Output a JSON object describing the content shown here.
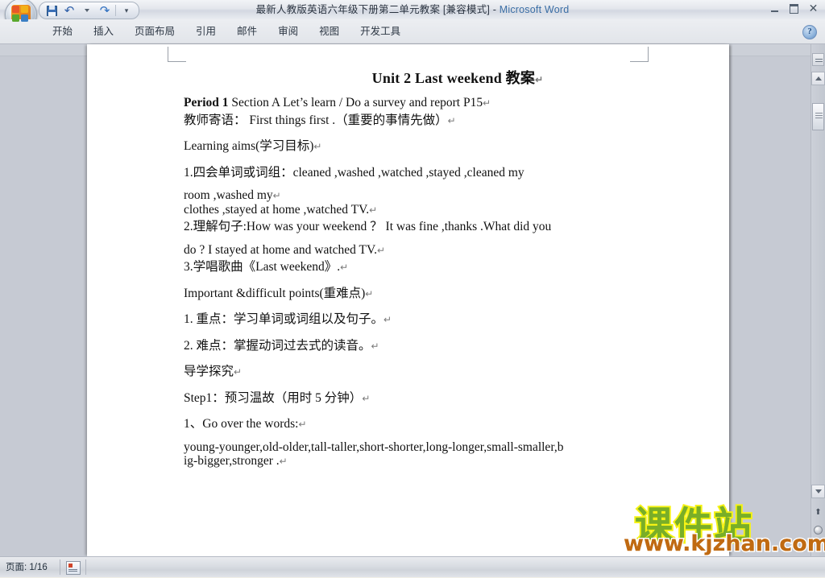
{
  "window": {
    "title": "最新人教版英语六年级下册第二单元教案 [兼容模式] - ",
    "app_name": "Microsoft Word",
    "controls": {
      "minimize": "—",
      "restore": "❐",
      "close": "✕"
    }
  },
  "quick_access": {
    "save_label": "保存",
    "undo_label": "撤消",
    "undo_dropdown_label": "撤消下拉",
    "redo_label": "恢复",
    "customize_label": "自定义快速访问工具栏"
  },
  "ribbon": {
    "tabs": [
      {
        "label": "开始"
      },
      {
        "label": "插入"
      },
      {
        "label": "页面布局"
      },
      {
        "label": "引用"
      },
      {
        "label": "邮件"
      },
      {
        "label": "审阅"
      },
      {
        "label": "视图"
      },
      {
        "label": "开发工具"
      }
    ],
    "help_label": "?"
  },
  "document": {
    "title": "Unit 2 Last weekend 教案",
    "pilcrow": "↵",
    "paragraphs": [
      {
        "bold_prefix": "Period 1",
        "text": " Section A Let’s learn / Do a survey and report P15",
        "spacing": "gap-sm"
      },
      {
        "bold_prefix": "",
        "text": "教师寄语： First things first .（重要的事情先做）",
        "spacing": "gap-lg"
      },
      {
        "bold_prefix": "",
        "text": "Learning aims(学习目标)",
        "spacing": "gap-lg"
      },
      {
        "bold_prefix": "",
        "text": "1.四会单词或词组：cleaned ,washed ,watched ,stayed ,cleaned my",
        "spacing": "gap-md"
      },
      {
        "bold_prefix": "",
        "text": "room ,washed my",
        "spacing": "gap-xs"
      },
      {
        "bold_prefix": "",
        "text": "clothes ,stayed at home ,watched TV.",
        "spacing": "gap-sm"
      },
      {
        "bold_prefix": "",
        "text": "2.理解句子:How was your weekend ？  It was fine ,thanks .What did you",
        "spacing": "gap-md"
      },
      {
        "bold_prefix": "",
        "text": "do ? I stayed at home and watched TV.",
        "spacing": "gap-sm"
      },
      {
        "bold_prefix": "",
        "text": "3.学唱歌曲《Last weekend》.",
        "spacing": "gap-lg"
      },
      {
        "bold_prefix": "",
        "text": "Important &difficult points(重难点)",
        "spacing": "gap-lg"
      },
      {
        "bold_prefix": "",
        "text": "1. 重点：学习单词或词组以及句子。",
        "spacing": "gap-lg"
      },
      {
        "bold_prefix": "",
        "text": "2. 难点：掌握动词过去式的读音。",
        "spacing": "gap-lg"
      },
      {
        "bold_prefix": "",
        "text": "导学探究",
        "spacing": "gap-lg"
      },
      {
        "bold_prefix": "",
        "text": "Step1：预习温故（用时 5 分钟）",
        "spacing": "gap-lg"
      },
      {
        "bold_prefix": "",
        "text": "1、Go over the words:",
        "spacing": "gap-md"
      },
      {
        "bold_prefix": "",
        "text": "young-younger,old-older,tall-taller,short-shorter,long-longer,small-smaller,b",
        "spacing": "gap-xs"
      },
      {
        "bold_prefix": "",
        "text": "ig-bigger,stronger .",
        "spacing": "gap-xs"
      }
    ]
  },
  "scrollbar": {
    "up_label": "向上滚动",
    "down_label": "向下滚动",
    "split_label": "拆分",
    "prev_page_label": "上一页",
    "browse_object_label": "选择浏览对象",
    "next_page_label": "下一页",
    "prev_glyph": "⬆",
    "next_glyph": "⬇"
  },
  "status_bar": {
    "page_label": "页面: 1/16",
    "view_icon_label": "视图"
  },
  "watermark": {
    "brand": "课件站",
    "url": "www.kjzhan.com",
    "brand_fill": "#79ae28",
    "brand_outline": "#f5f215",
    "url_color": "#c06a12"
  }
}
